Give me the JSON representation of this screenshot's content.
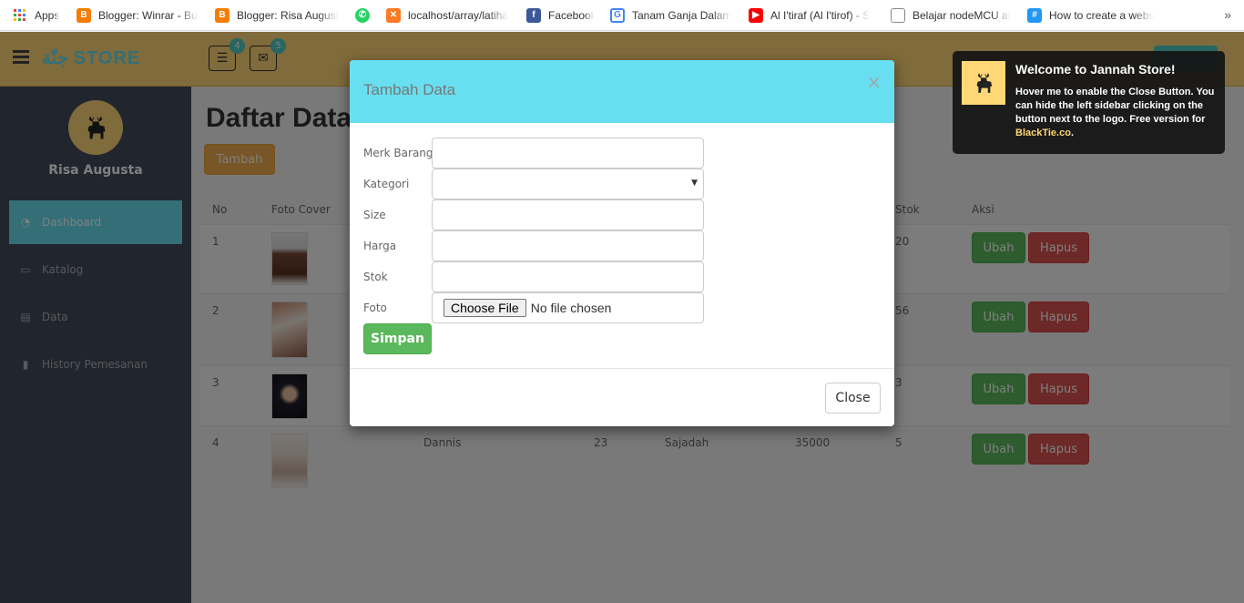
{
  "bookmarks": [
    {
      "label": "Apps",
      "icon": "apps-grid-icon",
      "color": "#4285f4"
    },
    {
      "label": "Blogger: Winrar - Bua",
      "icon": "blogger-icon",
      "color": "#f57d00"
    },
    {
      "label": "Blogger: Risa Augusti",
      "icon": "blogger-icon",
      "color": "#f57d00"
    },
    {
      "label": "",
      "icon": "whatsapp-icon",
      "color": "#25d366"
    },
    {
      "label": "localhost/array/latiha",
      "icon": "xampp-icon",
      "color": "#fb7a24"
    },
    {
      "label": "Facebook",
      "icon": "facebook-icon",
      "color": "#3b5998"
    },
    {
      "label": "Tanam Ganja Dalam",
      "icon": "g-icon",
      "color": "#4285f4"
    },
    {
      "label": "Al I'tiraf (Al I'tirof) - S",
      "icon": "youtube-icon",
      "color": "#ff0000"
    },
    {
      "label": "Belajar nodeMCU ard",
      "icon": "page-icon",
      "color": "#888888"
    },
    {
      "label": "How to create a webs",
      "icon": "hashnode-icon",
      "color": "#2196f3"
    }
  ],
  "bookmarks_more": "»",
  "header": {
    "logo_arabic": "جنّة",
    "logo_text": "STORE",
    "tasks_badge": "4",
    "mail_badge": "5"
  },
  "sidebar": {
    "username": "Risa Augusta",
    "items": [
      {
        "label": "Dashboard",
        "icon": "dashboard-icon"
      },
      {
        "label": "Katalog",
        "icon": "monitor-icon"
      },
      {
        "label": "Data",
        "icon": "book-icon"
      },
      {
        "label": "History Pemesanan",
        "icon": "bookmark-icon"
      }
    ]
  },
  "main": {
    "title": "Daftar Data",
    "add_button": "Tambah",
    "columns": [
      "No",
      "Foto Cover",
      "Stok",
      "Aksi"
    ],
    "rows": [
      {
        "no": "1",
        "merk": "",
        "size": "",
        "kategori": "",
        "harga": "",
        "stok": "20"
      },
      {
        "no": "2",
        "merk": "",
        "size": "",
        "kategori": "",
        "harga": "",
        "stok": "56"
      },
      {
        "no": "3",
        "merk": "",
        "size": "",
        "kategori": "",
        "harga": "",
        "stok": "3"
      },
      {
        "no": "4",
        "merk": "Dannis",
        "size": "23",
        "kategori": "Sajadah",
        "harga": "35000",
        "stok": "5"
      }
    ],
    "edit_label": "Ubah",
    "delete_label": "Hapus"
  },
  "modal": {
    "title": "Tambah Data",
    "close_x": "×",
    "labels": [
      "Merk Barang",
      "Kategori",
      "Size",
      "Harga",
      "Stok",
      "Foto"
    ],
    "values": {
      "merk": "",
      "kategori": "",
      "size": "",
      "harga": "",
      "stok": ""
    },
    "file_button": "Choose File",
    "file_status": "No file chosen",
    "submit_label": "Simpan",
    "close_label": "Close"
  },
  "notification": {
    "title": "Welcome to Jannah Store!",
    "text": "Hover me to enable the Close Button. You can hide the left sidebar clicking on the button next to the logo. Free version for",
    "link": "BlackTie.co",
    "suffix": "."
  },
  "colors": {
    "header": "#ffd777",
    "sidebar": "#424a5d",
    "accent": "#68dff0",
    "success": "#5cb85c",
    "danger": "#d9534f",
    "warning": "#f0ad4e"
  }
}
